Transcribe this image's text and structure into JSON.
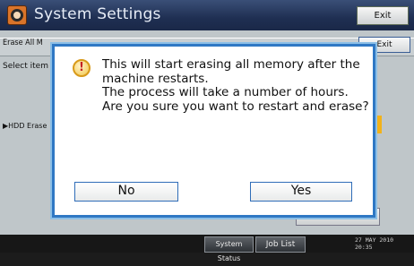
{
  "header": {
    "title": "System Settings",
    "exit_label": "Exit"
  },
  "panel": {
    "row_label": "Erase All M",
    "exit_label": "Exit",
    "select_label": "Select item",
    "hdd_label": "▶HDD Erase"
  },
  "dialog": {
    "message_lines": [
      "This will start erasing all memory after the",
      "machine restarts.",
      "The process will take a number of hours.",
      "Are you sure you want to restart and erase?"
    ],
    "no_label": "No",
    "yes_label": "Yes",
    "icon": "warning-icon"
  },
  "statusbar": {
    "system_status_label": "System Status",
    "job_list_label": "Job List",
    "date": "27 MAY  2010",
    "time": "20:35"
  },
  "colors": {
    "accent": "#2f78c4",
    "warning": "#f2c64a"
  }
}
